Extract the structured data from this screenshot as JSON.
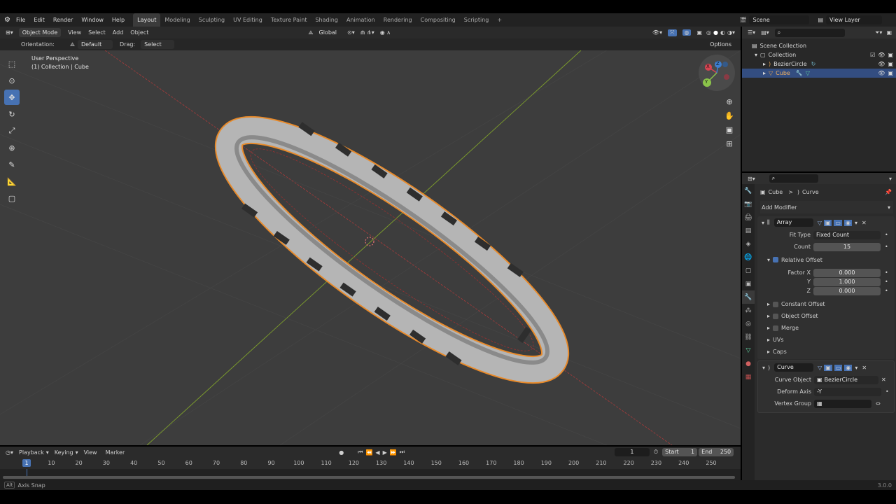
{
  "menubar": {
    "menus": [
      "File",
      "Edit",
      "Render",
      "Window",
      "Help"
    ],
    "workspaces": [
      "Layout",
      "Modeling",
      "Sculpting",
      "UV Editing",
      "Texture Paint",
      "Shading",
      "Animation",
      "Rendering",
      "Compositing",
      "Scripting"
    ],
    "add_tab": "+",
    "scene": "Scene",
    "view_layer": "View Layer"
  },
  "viewport_header": {
    "mode": "Object Mode",
    "menus": [
      "View",
      "Select",
      "Add",
      "Object"
    ],
    "transform": "Global",
    "options": "Options"
  },
  "tool_settings": {
    "orientation_label": "Orientation:",
    "orientation_value": "Default",
    "drag_label": "Drag:",
    "drag_value": "Select Box"
  },
  "viewport": {
    "line1": "User Perspective",
    "line2": "(1) Collection | Cube",
    "gizmo_x": "X",
    "gizmo_y": "Y",
    "gizmo_z": "Z"
  },
  "outliner": {
    "items": [
      {
        "label": "Scene Collection"
      },
      {
        "label": "Collection"
      },
      {
        "label": "BezierCircle"
      },
      {
        "label": "Cube"
      }
    ]
  },
  "properties": {
    "breadcrumb_obj": "Cube",
    "breadcrumb_sep": ">",
    "breadcrumb_data": "Curve",
    "add_modifier": "Add Modifier",
    "array": {
      "name": "Array",
      "fit_type_label": "Fit Type",
      "fit_type_value": "Fixed Count",
      "count_label": "Count",
      "count_value": "15",
      "relative_offset": "Relative Offset",
      "factor_x_label": "Factor X",
      "factor_x": "0.000",
      "y_label": "Y",
      "factor_y": "1.000",
      "z_label": "Z",
      "factor_z": "0.000",
      "constant_offset": "Constant Offset",
      "object_offset": "Object Offset",
      "merge": "Merge",
      "uvs": "UVs",
      "caps": "Caps"
    },
    "curve": {
      "name": "Curve",
      "curve_object_label": "Curve Object",
      "curve_object_value": "BezierCircle",
      "deform_axis_label": "Deform Axis",
      "deform_axis_value": "-Y",
      "vertex_group_label": "Vertex Group"
    }
  },
  "timeline": {
    "menus": [
      "Playback",
      "Keying",
      "View",
      "Marker"
    ],
    "current_frame": "1",
    "start_label": "Start",
    "start_value": "1",
    "end_label": "End",
    "end_value": "250",
    "ticks": [
      "1",
      "10",
      "20",
      "30",
      "40",
      "50",
      "60",
      "70",
      "80",
      "90",
      "100",
      "110",
      "120",
      "130",
      "140",
      "150",
      "160",
      "170",
      "180",
      "190",
      "200",
      "210",
      "220",
      "230",
      "240",
      "250"
    ]
  },
  "status": {
    "hint_key": "Alt",
    "hint": "Axis Snap",
    "version": "3.0.0"
  },
  "colors": {
    "accent": "#4772b3",
    "selection_outline": "#e88a2a",
    "x_axis": "#a23a3a",
    "y_axis": "#7fa12b"
  }
}
